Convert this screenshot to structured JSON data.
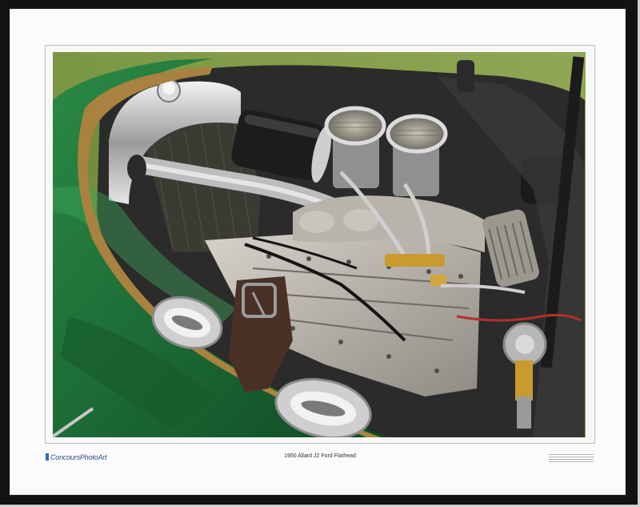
{
  "print": {
    "brand": "ConcoursPhotoArt",
    "caption": "1950 Allard J2 Ford Flathead"
  },
  "colors": {
    "frame": "#121212",
    "mat": "#fbfbfb",
    "car_green": "#1f6b34",
    "grass": "#7f9a4a",
    "brand_blue": "#2d4f8a"
  }
}
